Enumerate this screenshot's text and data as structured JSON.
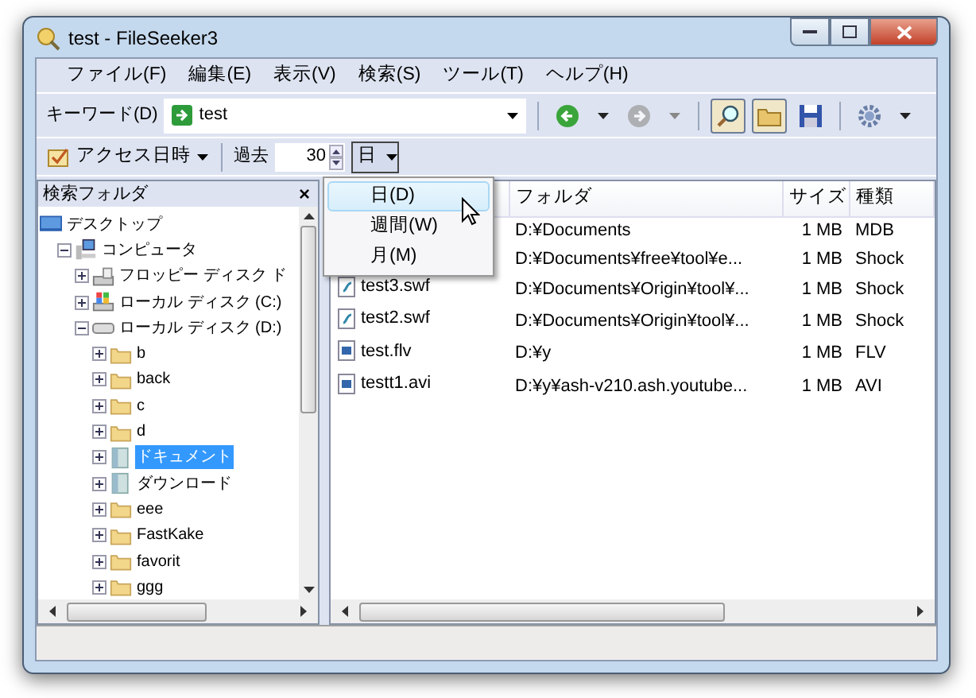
{
  "window": {
    "title": "test - FileSeeker3"
  },
  "menu": [
    "ファイル(F)",
    "編集(E)",
    "表示(V)",
    "検索(S)",
    "ツール(T)",
    "ヘルプ(H)"
  ],
  "keyword": {
    "label": "キーワード(D)",
    "value": "test"
  },
  "tools": [
    {
      "kind": "back",
      "pressed": false,
      "disabled": false
    },
    {
      "kind": "forward",
      "pressed": false,
      "disabled": true
    },
    {
      "kind": "search",
      "pressed": true,
      "disabled": false
    },
    {
      "kind": "folder",
      "pressed": true,
      "disabled": false
    },
    {
      "kind": "save",
      "pressed": false,
      "disabled": false
    },
    {
      "kind": "settings",
      "pressed": false,
      "disabled": false
    }
  ],
  "filter": {
    "field": "アクセス日時",
    "past_label": "過去",
    "amount": "30",
    "unit": "日"
  },
  "unit_menu": [
    {
      "label": "日(D)",
      "selected": true
    },
    {
      "label": "週間(W)",
      "selected": false
    },
    {
      "label": "月(M)",
      "selected": false
    }
  ],
  "folder_panel": {
    "title": "検索フォルダ",
    "close": "×",
    "tree": [
      {
        "label": "デスクトップ",
        "kind": "desktop",
        "selected": false,
        "children": [
          {
            "label": "コンピュータ",
            "kind": "computer",
            "expanded": true,
            "selected": false,
            "children": [
              {
                "label": "フロッピー ディスク ド",
                "kind": "floppy",
                "expanded": false,
                "selected": false
              },
              {
                "label": "ローカル ディスク (C:)",
                "kind": "system",
                "expanded": false,
                "selected": false
              },
              {
                "label": "ローカル ディスク (D:)",
                "kind": "drive",
                "expanded": true,
                "selected": false,
                "children": [
                  {
                    "label": "b",
                    "kind": "folder",
                    "expanded": false,
                    "selected": false
                  },
                  {
                    "label": "back",
                    "kind": "folder",
                    "expanded": false,
                    "selected": false
                  },
                  {
                    "label": "c",
                    "kind": "folder",
                    "expanded": false,
                    "selected": false
                  },
                  {
                    "label": "d",
                    "kind": "folder",
                    "expanded": false,
                    "selected": false
                  },
                  {
                    "label": "ドキュメント",
                    "kind": "library",
                    "expanded": false,
                    "selected": true
                  },
                  {
                    "label": "ダウンロード",
                    "kind": "library",
                    "expanded": false,
                    "selected": false
                  },
                  {
                    "label": "eee",
                    "kind": "folder",
                    "expanded": false,
                    "selected": false
                  },
                  {
                    "label": "FastKake",
                    "kind": "folder",
                    "expanded": false,
                    "selected": false
                  },
                  {
                    "label": "favorit",
                    "kind": "folder",
                    "expanded": false,
                    "selected": false
                  },
                  {
                    "label": "ggg",
                    "kind": "folder",
                    "expanded": false,
                    "selected": false
                  }
                ]
              }
            ]
          }
        ]
      }
    ]
  },
  "table": {
    "columns": [
      "フォルダ",
      "サイズ",
      "種類"
    ],
    "rows": [
      {
        "folder": "D:¥Documents",
        "size": "1 MB",
        "type": "MDB"
      },
      {
        "folder": "D:¥Documents¥free¥tool¥e...",
        "size": "1 MB",
        "type": "Shock"
      },
      {
        "name": "test3.swf",
        "kind": "swf",
        "folder": "D:¥Documents¥Origin¥tool¥...",
        "size": "1 MB",
        "type": "Shock"
      },
      {
        "name": "test2.swf",
        "kind": "swf",
        "folder": "D:¥Documents¥Origin¥tool¥...",
        "size": "1 MB",
        "type": "Shock"
      },
      {
        "name": "test.flv",
        "kind": "video",
        "folder": "D:¥y",
        "size": "1 MB",
        "type": "FLV"
      },
      {
        "name": "testt1.avi",
        "kind": "video",
        "folder": "D:¥y¥ash-v210.ash.youtube...",
        "size": "1 MB",
        "type": "AVI"
      }
    ]
  }
}
